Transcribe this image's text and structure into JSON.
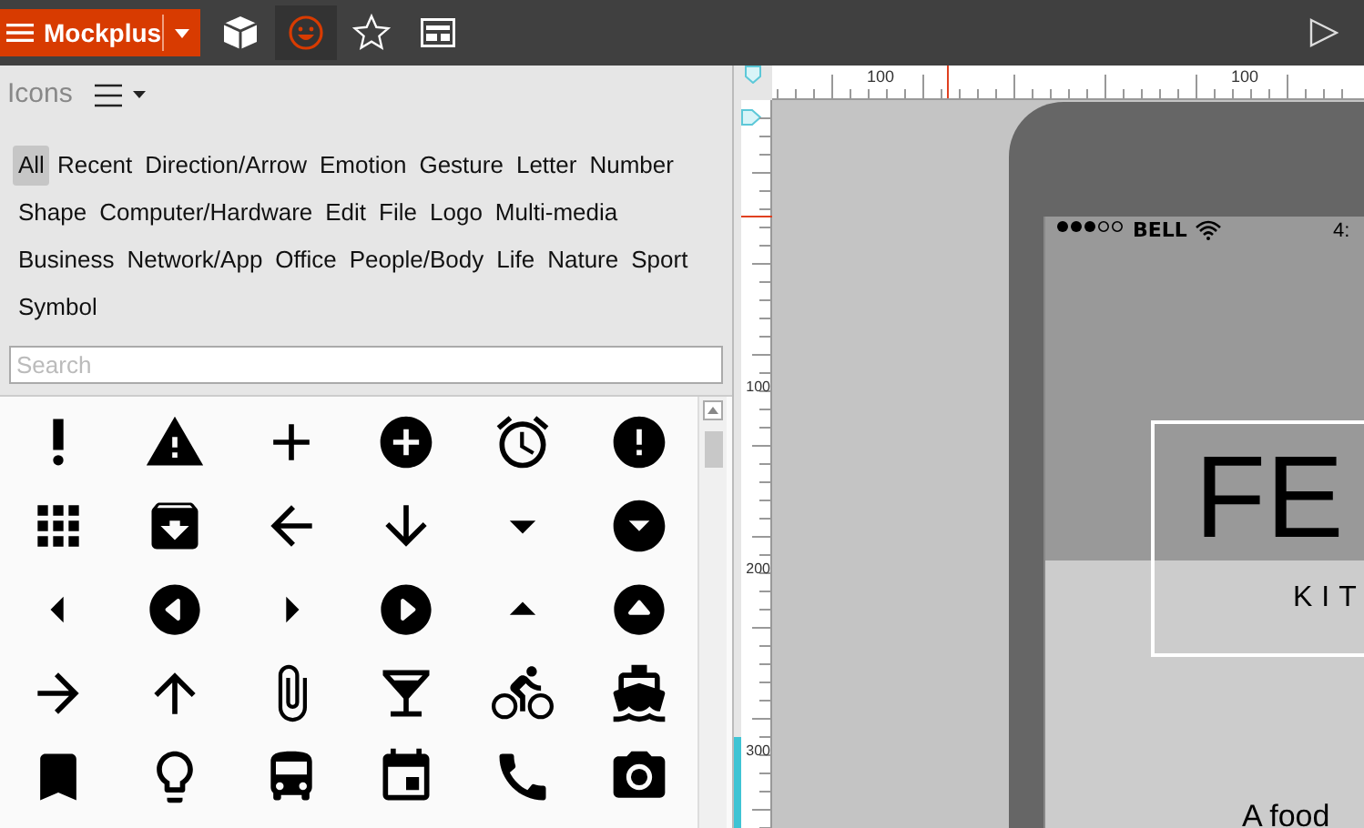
{
  "app_button": {
    "label": "Mockplus"
  },
  "toolbar_tools": [
    {
      "selected": false
    },
    {
      "selected": true
    },
    {
      "selected": false
    },
    {
      "selected": false
    }
  ],
  "panel": {
    "title": "Icons",
    "categories": [
      {
        "label": "All",
        "selected": true
      },
      {
        "label": "Recent",
        "selected": false
      },
      {
        "label": "Direction/Arrow",
        "selected": false
      },
      {
        "label": "Emotion",
        "selected": false
      },
      {
        "label": "Gesture",
        "selected": false
      },
      {
        "label": "Letter",
        "selected": false
      },
      {
        "label": "Number",
        "selected": false
      },
      {
        "label": "Shape",
        "selected": false
      },
      {
        "label": "Computer/Hardware",
        "selected": false
      },
      {
        "label": "Edit",
        "selected": false
      },
      {
        "label": "File",
        "selected": false
      },
      {
        "label": "Logo",
        "selected": false
      },
      {
        "label": "Multi-media",
        "selected": false
      },
      {
        "label": "Business",
        "selected": false
      },
      {
        "label": "Network/App",
        "selected": false
      },
      {
        "label": "Office",
        "selected": false
      },
      {
        "label": "People/Body",
        "selected": false
      },
      {
        "label": "Life",
        "selected": false
      },
      {
        "label": "Nature",
        "selected": false
      },
      {
        "label": "Sport",
        "selected": false
      },
      {
        "label": "Symbol",
        "selected": false
      }
    ],
    "search": {
      "placeholder": "Search"
    }
  },
  "rulers": {
    "horizontal": [
      "100",
      "100"
    ],
    "vertical": [
      "100",
      "200",
      "300"
    ]
  },
  "phone": {
    "carrier": "BELL",
    "time": "4:",
    "title": "FE",
    "subtitle": "KIT",
    "text": "A food"
  }
}
